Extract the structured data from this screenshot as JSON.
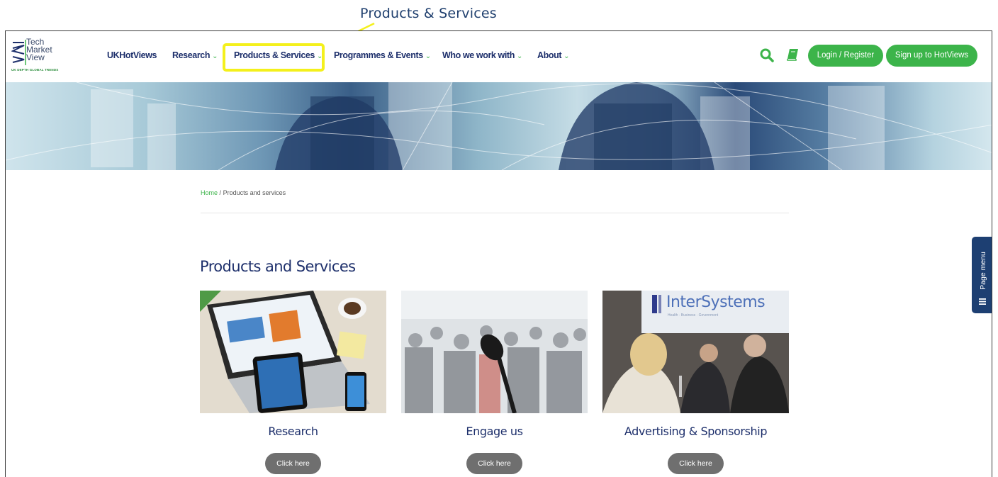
{
  "callout": {
    "label": "Products & Services"
  },
  "logo": {
    "line1": "Tech",
    "line2": "Market",
    "line3": "View",
    "tagline": "UK DEPTH GLOBAL TRENDS"
  },
  "nav": {
    "items": [
      {
        "label": "UKHotViews",
        "has_dropdown": false
      },
      {
        "label": "Research",
        "has_dropdown": true
      },
      {
        "label": "Products & Services",
        "has_dropdown": true
      },
      {
        "label": "Programmes & Events",
        "has_dropdown": true
      },
      {
        "label": "Who we work with",
        "has_dropdown": true
      },
      {
        "label": "About",
        "has_dropdown": true
      }
    ],
    "chevron": "⌄",
    "login_label": "Login / Register",
    "signup_label": "Sign up to HotViews"
  },
  "breadcrumb": {
    "home": "Home",
    "separator": "/",
    "current": "Products and services"
  },
  "page_title": "Products and Services",
  "cards": [
    {
      "title": "Research",
      "button": "Click here",
      "image": "laptop-desk-photo"
    },
    {
      "title": "Engage us",
      "button": "Click here",
      "image": "event-microphone-photo"
    },
    {
      "title": "Advertising & Sponsorship",
      "button": "Click here",
      "image": "intersystems-event-photo",
      "image_text": "InterSystems",
      "image_subtext": "Health · Business · Government"
    }
  ],
  "page_menu": {
    "label": "Page menu"
  },
  "colors": {
    "brand_navy": "#1d2f6b",
    "accent_green": "#3cb44a",
    "highlight_yellow": "#f4f01c",
    "button_grey": "#6f6f6f",
    "page_menu_bg": "#1d3f72"
  }
}
